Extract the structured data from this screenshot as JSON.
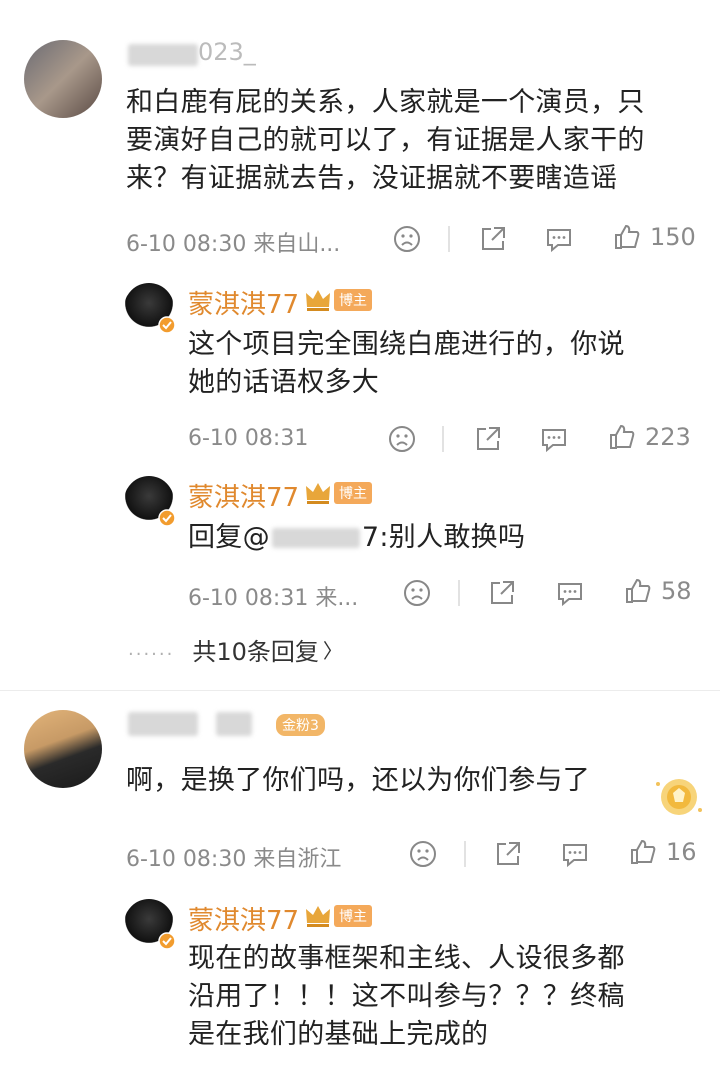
{
  "comments": [
    {
      "username_visible": "023_",
      "text_lines": [
        "和白鹿有屁的关系，人家就是一个演员，只",
        "要演好自己的就可以了，有证据是人家干的",
        "来？有证据就去告，没证据就不要瞎造谣"
      ],
      "time": "6-10 08:30 来自山...",
      "likes": "150"
    },
    {
      "fans_badge": "金粉3",
      "text": "啊，是换了你们吗，还以为你们参与了",
      "time": "6-10 08:30 来自浙江",
      "likes": "16"
    }
  ],
  "replies": [
    {
      "name": "蒙淇淇77",
      "badge": "博主",
      "text_lines": [
        "这个项目完全围绕白鹿进行的，你说",
        "她的话语权多大"
      ],
      "time": "6-10 08:31",
      "likes": "223"
    },
    {
      "name": "蒙淇淇77",
      "badge": "博主",
      "text_prefix": "回复@",
      "text_mid": "7",
      "text_suffix": ":别人敢换吗",
      "time": "6-10 08:31 来...",
      "likes": "58"
    },
    {
      "name": "蒙淇淇77",
      "badge": "博主",
      "text_lines": [
        "现在的故事框架和主线、人设很多都",
        "沿用了！！！这不叫参与？？？终稿",
        "是在我们的基础上完成的"
      ]
    }
  ],
  "more_replies": {
    "dots": "......",
    "label": "共10条回复",
    "chevron": "〉"
  },
  "colors": {
    "accent_orange": "#e0892e",
    "meta_gray": "#8a8a8a",
    "divider": "#e2e2e2"
  },
  "icons": [
    "sad-face-icon",
    "share-icon",
    "comment-icon",
    "like-icon",
    "crown-icon",
    "verified-icon",
    "gold-fan-icon"
  ]
}
